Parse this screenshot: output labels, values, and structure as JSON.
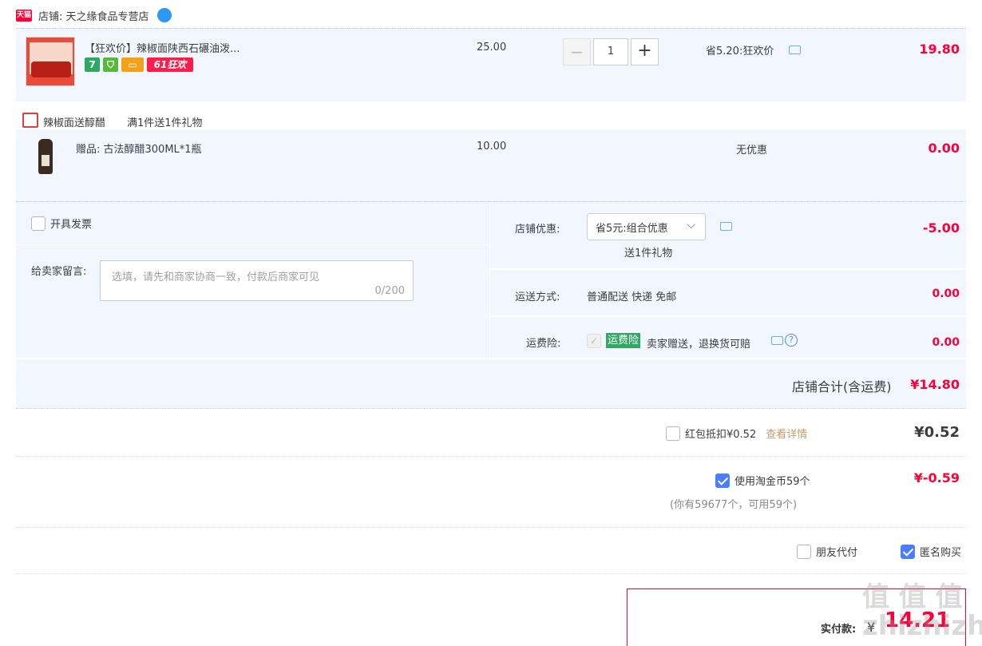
{
  "shop": {
    "badge": "天猫",
    "label": "店铺: 天之缘食品专营店"
  },
  "product": {
    "title": "【狂欢价】辣椒面陕西石碾油泼...",
    "tags": [
      "7",
      "",
      "",
      "61狂欢"
    ],
    "price": "25.00",
    "quantity": "1",
    "promo": "省5.20:狂欢价",
    "total": "19.80"
  },
  "gift_promo": {
    "name": "辣椒面送醇醋",
    "rule": "满1件送1件礼物"
  },
  "gift": {
    "title": "赠品: 古法醇醋300ML*1瓶",
    "price": "10.00",
    "promo": "无优惠",
    "total": "0.00"
  },
  "invoice": {
    "label": "开具发票"
  },
  "message": {
    "label": "给卖家留言:",
    "placeholder": "选填，请先和商家协商一致，付款后商家可见",
    "counter": "0/200"
  },
  "shop_discount": {
    "label": "店铺优惠:",
    "selected": "省5元:组合优惠",
    "note": "送1件礼物",
    "amount": "-5.00"
  },
  "shipping": {
    "label": "运送方式:",
    "value": "普通配送 快递 免邮",
    "amount": "0.00"
  },
  "insurance": {
    "label": "运费险:",
    "badge": "运费险",
    "value": "卖家赠送，退换货可赔",
    "amount": "0.00"
  },
  "shop_total": {
    "label": "店铺合计(含运费)",
    "amount": "¥14.80"
  },
  "red_packet": {
    "label": "红包抵扣¥0.52",
    "link": "查看详情",
    "amount": "¥0.52"
  },
  "coins": {
    "label": "使用淘金币59个",
    "note": "(你有59677个，可用59个)",
    "amount": "¥-0.59"
  },
  "options": {
    "friend_pay": "朋友代付",
    "anonymous": "匿名购买"
  },
  "payment": {
    "label": "实付款:",
    "currency": "¥",
    "amount": "14.21"
  },
  "watermark": "值 值 值\nzhizhizhi.com",
  "colors": {
    "accent": "#ff0036",
    "tmall": "#ff0036",
    "blue_bg": "#f2f7ff",
    "check": "#4a7dff",
    "green": "#31a862"
  }
}
